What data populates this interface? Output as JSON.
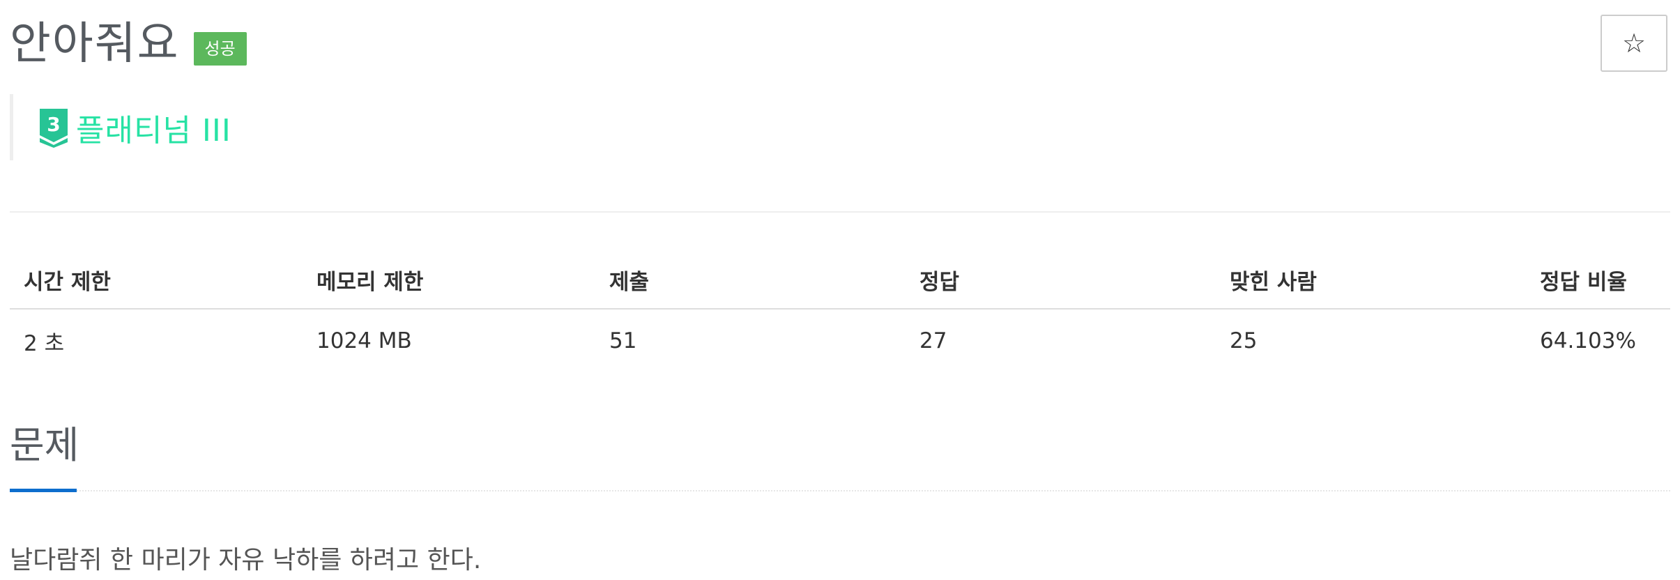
{
  "problem": {
    "title": "안아줘요",
    "result_badge": "성공",
    "favorite_icon": "star-outline-icon",
    "favorite_glyph": "☆"
  },
  "tier": {
    "level_number": "3",
    "label": "플래티넘 III",
    "color": "#27e2a4",
    "icon": "tier-badge-icon"
  },
  "info_table": {
    "headers": [
      "시간 제한",
      "메모리 제한",
      "제출",
      "정답",
      "맞힌 사람",
      "정답 비율"
    ],
    "rows": [
      [
        "2 초",
        "1024 MB",
        "51",
        "27",
        "25",
        "64.103%"
      ]
    ]
  },
  "section": {
    "title": "문제",
    "accent_color": "#0d6ecd"
  },
  "description": {
    "text": "날다람쥐 한 마리가 자유 낙하를 하려고 한다."
  },
  "colors": {
    "success_badge": "#5cb85c",
    "title_text": "#555a60"
  }
}
